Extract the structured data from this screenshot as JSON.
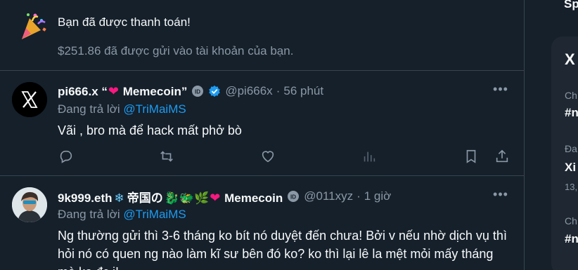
{
  "notification": {
    "title": "Bạn đã được thanh toán!",
    "subtitle": "$251.86 đã được gửi vào tài khoản của bạn."
  },
  "tweets": [
    {
      "name_prefix": "pi666.x “",
      "name_suffix": " Memecoin”",
      "handle": "@pi666x",
      "separator": "·",
      "time": "56 phút",
      "reply_prefix": "Đang trả lời ",
      "reply_handle": "@TriMaiMS",
      "text": "Vãi , bro mà để hack mất phở bò"
    },
    {
      "name_prefix": "9k999.eth",
      "name_cjk": "帝国の",
      "name_emojis": "🐉🐲🌿",
      "name_suffix": " Memecoin",
      "handle": "@011xyz",
      "separator": "·",
      "time": "1 giờ",
      "reply_prefix": "Đang trả lời ",
      "reply_handle": "@TriMaiMS",
      "text": "Ng thường gửi thì 3-6 tháng ko bít nó duyệt đến chưa! Bởi v nếu nhờ dịch vụ thì hỏi nó có quen ng nào làm kĩ sư bên đó ko? ko thì lại lê la mệt mỏi mấy tháng mà ko đc i!"
    }
  ],
  "sidebar": {
    "top_text": "Sp",
    "card_title": "X",
    "rows": [
      {
        "label": "Ch",
        "value": "#n"
      },
      {
        "label": "Đa",
        "value": "Xi",
        "count": "13,"
      },
      {
        "label": "Ch",
        "value": "#n"
      }
    ]
  },
  "colors": {
    "background": "#15202b",
    "accent": "#1d9bf0",
    "muted": "#8b98a5",
    "heart": "#f91880",
    "verified": "#1d9bf0"
  },
  "icons": [
    "party-popper-icon",
    "x-logo-icon",
    "id-badge-icon",
    "verified-icon",
    "more-icon",
    "reply-icon",
    "repost-icon",
    "like-icon",
    "views-icon",
    "bookmark-icon",
    "share-icon",
    "snowflake-icon",
    "heart-icon"
  ]
}
